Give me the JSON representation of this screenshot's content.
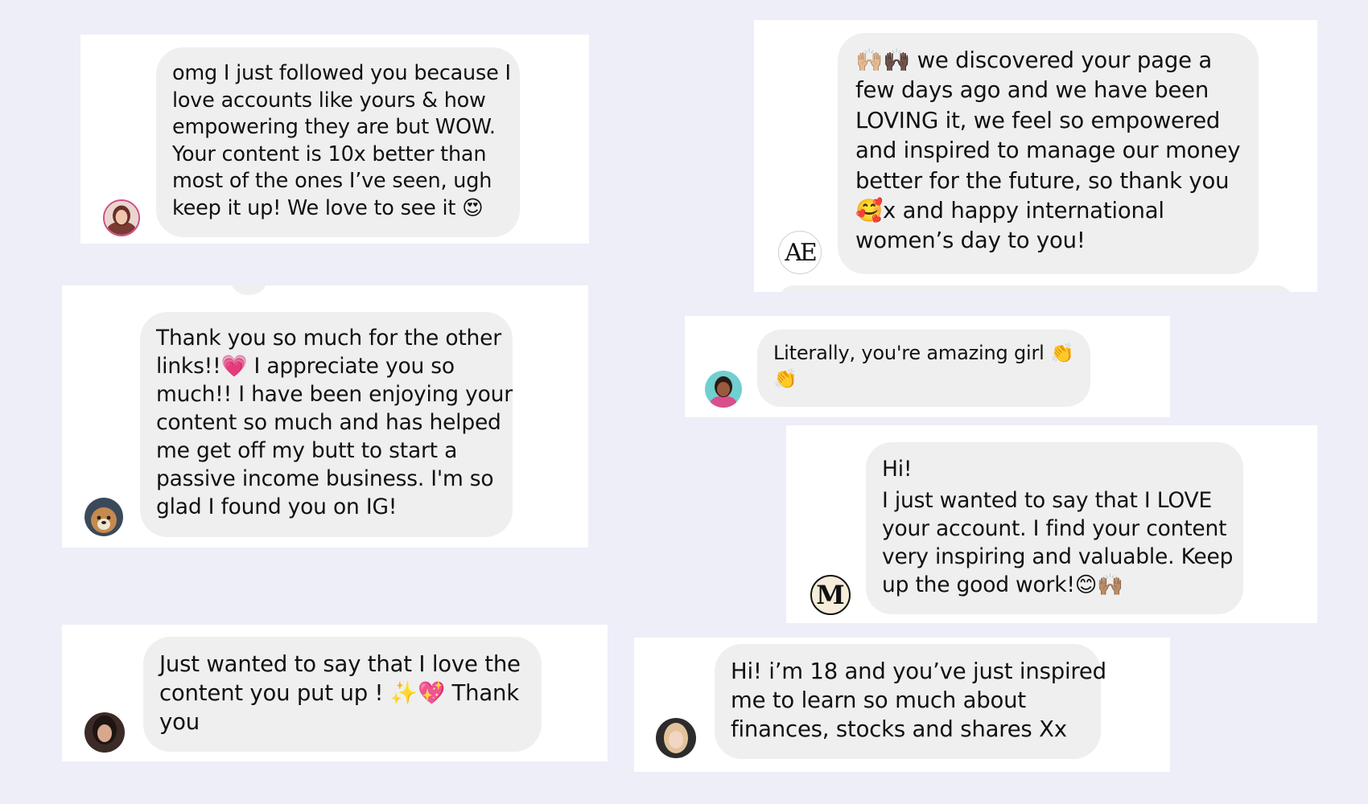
{
  "background_color": "#eeeef9",
  "bubble_color": "#efefef",
  "messages": [
    {
      "id": "msg-1",
      "avatar": "profile-photo-woman-red-hair",
      "lines": [
        "omg I just followed you because I",
        "love accounts like yours & how",
        "empowering they are but WOW.",
        "Your content is 10x better than",
        "most of the ones I’ve seen, ugh",
        "keep it up! We love to see it 😍"
      ]
    },
    {
      "id": "msg-2",
      "avatar": "logo-ae",
      "avatar_text": "AE",
      "lines": [
        "🙌🏼🙌🏿 we discovered your page a",
        "few days ago and we have been",
        "LOVING it, we feel so empowered",
        "and inspired to manage our money",
        "better for the future, so thank you",
        "🥰x and happy international",
        "women’s day to you!"
      ]
    },
    {
      "id": "msg-3",
      "avatar": "profile-photo-dog",
      "lines": [
        "Thank you so much for the other",
        "links!!💗  I appreciate you so",
        "much!! I have been enjoying your",
        "content so much and has helped",
        "me get off my butt to start a",
        "passive income business. I'm so",
        "glad I found you on IG!"
      ]
    },
    {
      "id": "msg-4",
      "avatar": "profile-photo-woman-teal",
      "lines": [
        "Literally,  you're amazing girl 👏",
        "👏"
      ]
    },
    {
      "id": "msg-5",
      "avatar": "logo-m",
      "avatar_text": "M",
      "lines": [
        "Hi!",
        "I just wanted to say that I LOVE",
        "your account. I find your content",
        "very inspiring and valuable. Keep",
        "up the good work!😊🙌🏽"
      ]
    },
    {
      "id": "msg-6",
      "avatar": "profile-photo-woman-dark-hair",
      "lines": [
        "Just wanted to say that I love the",
        "content you put up ! ✨💖 Thank",
        "you"
      ]
    },
    {
      "id": "msg-7",
      "avatar": "profile-photo-woman-blonde",
      "lines": [
        "Hi! i’m 18 and you’ve just inspired",
        "me to learn so much about",
        "finances, stocks and shares Xx"
      ]
    }
  ]
}
